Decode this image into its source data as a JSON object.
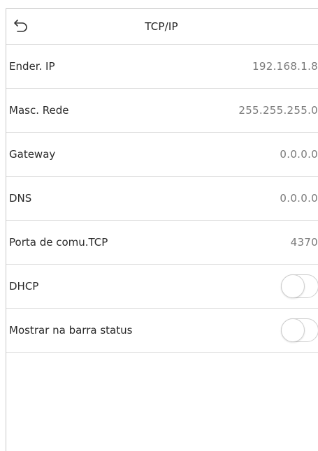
{
  "header": {
    "title": "TCP/IP",
    "back_icon": "back-arrow-icon"
  },
  "rows": [
    {
      "label": "Ender. IP",
      "value": "192.168.1.8"
    },
    {
      "label": "Masc. Rede",
      "value": "255.255.255.0"
    },
    {
      "label": "Gateway",
      "value": "0.0.0.0"
    },
    {
      "label": "DNS",
      "value": "0.0.0.0"
    },
    {
      "label": "Porta de comu.TCP",
      "value": "4370"
    }
  ],
  "toggles": [
    {
      "label": "DHCP",
      "state": "off"
    },
    {
      "label": "Mostrar na barra status",
      "state": "off"
    }
  ]
}
